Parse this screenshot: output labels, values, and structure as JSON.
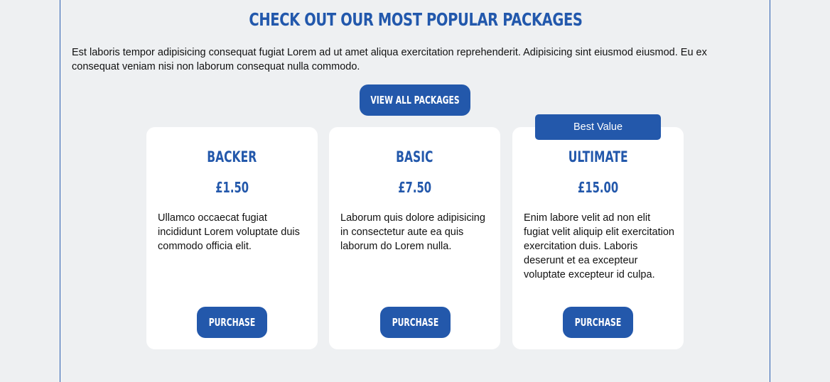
{
  "section": {
    "title": "Check out our most popular packages",
    "intro": "Est laboris tempor adipisicing consequat fugiat Lorem ad ut amet aliqua exercitation reprehenderit. Adipisicing sint eiusmod eiusmod. Eu ex consequat veniam nisi non laborum consequat nulla commodo.",
    "view_all_label": "View all packages"
  },
  "packages": [
    {
      "name": "Backer",
      "price": "£1.50",
      "description": "Ullamco occaecat fugiat incididunt Lorem voluptate duis commodo officia elit.",
      "button": "Purchase"
    },
    {
      "name": "Basic",
      "price": "£7.50",
      "description": "Laborum quis dolore adipisicing in consectetur aute ea quis laborum do Lorem nulla.",
      "button": "Purchase"
    },
    {
      "name": "Ultimate",
      "price": "£15.00",
      "description": "Enim labore velit ad non elit fugiat velit aliquip elit exercitation exercitation duis. Laboris deserunt et ea excepteur voluptate excepteur id culpa.",
      "button": "Purchase",
      "badge": "Best Value"
    }
  ],
  "colors": {
    "accent": "#2358ab",
    "background": "#eef0f2",
    "card": "#ffffff"
  }
}
